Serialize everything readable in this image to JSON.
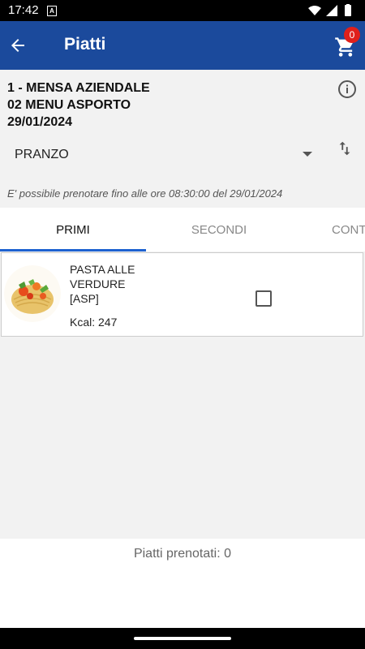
{
  "status_bar": {
    "time": "17:42",
    "a_badge": "A"
  },
  "app_bar": {
    "title": "Piatti",
    "cart_count": "0"
  },
  "header": {
    "line1": "1 - MENSA AZIENDALE",
    "line2": "02 MENU ASPORTO",
    "date": "29/01/2024",
    "meal_selected": "PRANZO",
    "notice": "E' possibile prenotare fino alle ore 08:30:00 del 29/01/2024"
  },
  "tabs": [
    {
      "label": "PRIMI"
    },
    {
      "label": "SECONDI"
    },
    {
      "label": "CONT"
    }
  ],
  "dishes": [
    {
      "name": "PASTA ALLE VERDURE",
      "code": "[ASP]",
      "kcal": "Kcal: 247",
      "checked": false
    }
  ],
  "footer": {
    "text": "Piatti prenotati: 0"
  },
  "colors": {
    "appbar": "#1b4a9c",
    "tab_indicator": "#1e62d0",
    "badge": "#e0201b"
  }
}
